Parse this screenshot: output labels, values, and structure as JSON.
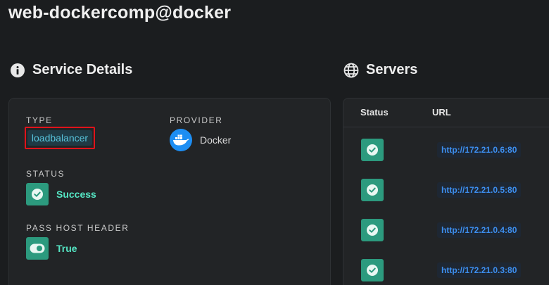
{
  "title": "web-dockercomp@docker",
  "service_details": {
    "heading": "Service Details",
    "icon": "info-circle-icon",
    "type_label": "TYPE",
    "type_value": "loadbalancer",
    "provider_label": "PROVIDER",
    "provider_icon": "docker-icon",
    "provider_value": "Docker",
    "status_label": "STATUS",
    "status_icon": "check-circle-icon",
    "status_value": "Success",
    "pass_host_header_label": "PASS HOST HEADER",
    "pass_host_header_icon": "toggle-on-icon",
    "pass_host_header_value": "True"
  },
  "servers": {
    "heading": "Servers",
    "icon": "globe-icon",
    "columns": [
      "Status",
      "URL"
    ],
    "rows": [
      {
        "status_icon": "check-circle-icon",
        "url": "http://172.21.0.6:80"
      },
      {
        "status_icon": "check-circle-icon",
        "url": "http://172.21.0.5:80"
      },
      {
        "status_icon": "check-circle-icon",
        "url": "http://172.21.0.4:80"
      },
      {
        "status_icon": "check-circle-icon",
        "url": "http://172.21.0.3:80"
      }
    ]
  },
  "colors": {
    "background": "#1b1d1f",
    "card": "#222426",
    "success_green": "#2c9a7e",
    "success_text": "#55e6c4",
    "link_blue": "#3d8ff0",
    "highlight_red": "#e0131a",
    "docker_blue": "#1d8ef3"
  }
}
